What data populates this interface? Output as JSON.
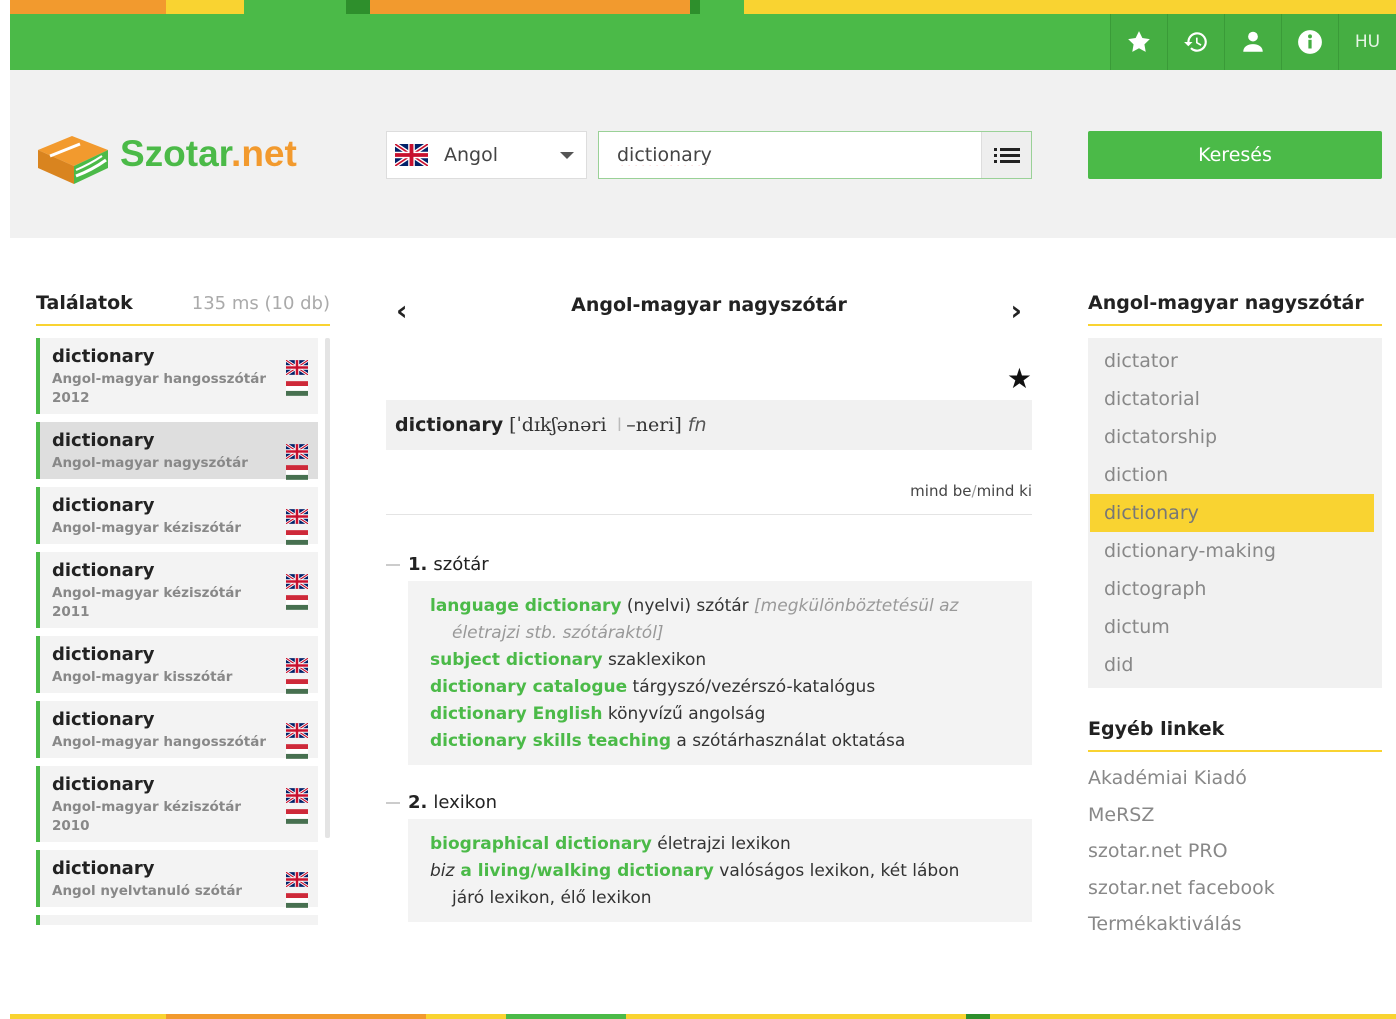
{
  "topbar": {
    "lang_label": "HU",
    "icons": [
      "star-icon",
      "history-icon",
      "user-icon",
      "info-icon"
    ]
  },
  "logo": {
    "text_a": "Szotar",
    "text_b": ".net"
  },
  "search": {
    "language_label": "Angol",
    "query": "dictionary",
    "button_label": "Keresés"
  },
  "results": {
    "title": "Találatok",
    "stats": "135 ms (10 db)",
    "items": [
      {
        "word": "dictionary",
        "dict": "Angol-magyar hangosszótár 2012"
      },
      {
        "word": "dictionary",
        "dict": "Angol-magyar nagyszótár"
      },
      {
        "word": "dictionary",
        "dict": "Angol-magyar kéziszótár"
      },
      {
        "word": "dictionary",
        "dict": "Angol-magyar kéziszótár 2011"
      },
      {
        "word": "dictionary",
        "dict": "Angol-magyar kisszótár"
      },
      {
        "word": "dictionary",
        "dict": "Angol-magyar hangosszótár"
      },
      {
        "word": "dictionary",
        "dict": "Angol-magyar kéziszótár 2010"
      },
      {
        "word": "dictionary",
        "dict": "Angol nyelvtanuló szótár"
      }
    ]
  },
  "entry": {
    "dictionary_title": "Angol-magyar nagyszótár",
    "prev_arrow": "‹",
    "next_arrow": "›",
    "headword": "dictionary",
    "ipa_a": "[ˈdɪkʃənəri",
    "ipa_sep": "ǀ",
    "ipa_b": "–neri]",
    "pos": "fn",
    "expand_all": "mind be",
    "slash": "/",
    "collapse_all": "mind ki",
    "senses": [
      {
        "num": "1.",
        "label": "szótár",
        "lines": {
          "l1_phrase": "language dictionary",
          "l1_text": " (nyelvi) szótár ",
          "l1_note": "[megkülönböztetésül az",
          "l1_note2": "életrajzi stb. szótáraktól]",
          "l2_phrase": "subject dictionary",
          "l2_text": " szaklexikon",
          "l3_phrase": "dictionary catalogue",
          "l3_text": " tárgyszó/vezérszó-katalógus",
          "l4_phrase": "dictionary English",
          "l4_text": " könyvízű angolság",
          "l5_phrase": "dictionary skills teaching",
          "l5_text": " a szótárhasználat oktatása"
        }
      },
      {
        "num": "2.",
        "label": "lexikon",
        "lines": {
          "l1_phrase": "biographical dictionary",
          "l1_text": " életrajzi lexikon",
          "l2_style": "biz",
          "l2_phrase": " a living/walking dictionary",
          "l2_text": " valóságos lexikon, két lábon",
          "l2_text2": "járó lexikon, élő lexikon"
        }
      }
    ]
  },
  "wordlist": {
    "title": "Angol-magyar nagyszótár",
    "items": [
      "dictator",
      "dictatorial",
      "dictatorship",
      "diction",
      "dictionary",
      "dictionary-making",
      "dictograph",
      "dictum",
      "did"
    ]
  },
  "links": {
    "title": "Egyéb linkek",
    "items": [
      "Akadémiai Kiadó",
      "MeRSZ",
      "szotar.net PRO",
      "szotar.net facebook",
      "Termékaktiválás"
    ]
  },
  "colors": {
    "green": "#4bba48",
    "yellow": "#f9d331",
    "orange": "#f29a2e"
  }
}
